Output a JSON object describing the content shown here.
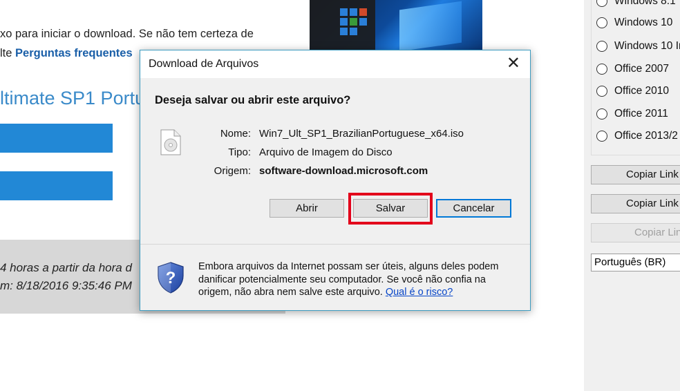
{
  "background_page": {
    "text_line1": "xo para iniciar o download. Se não tem certeza de",
    "text_line2_prefix": "lte ",
    "text_line2_link": "Perguntas frequentes",
    "heading": "ltimate SP1 Portu",
    "gray_line1": "4 horas a partir da hora d",
    "gray_line2": "m: 8/18/2016 9:35:46 PM"
  },
  "right_panel": {
    "radio_options": [
      "Windows 8.1",
      "Windows 10",
      "Windows 10 In",
      "Office 2007",
      "Office 2010",
      "Office 2011",
      "Office 2013/2"
    ],
    "copy_buttons": [
      "Copiar Link",
      "Copiar Link",
      "Copiar Lin"
    ],
    "language_select": "Português (BR)"
  },
  "dialog": {
    "title": "Download de Arquivos",
    "close_symbol": "✕",
    "question": "Deseja salvar ou abrir este arquivo?",
    "fields": [
      {
        "label": "Nome:",
        "value": "Win7_Ult_SP1_BrazilianPortuguese_x64.iso"
      },
      {
        "label": "Tipo:",
        "value": "Arquivo de Imagem do Disco"
      },
      {
        "label": "Origem:",
        "value": "software-download.microsoft.com"
      }
    ],
    "buttons": {
      "open": "Abrir",
      "save": "Salvar",
      "cancel": "Cancelar"
    },
    "warning_text": "Embora arquivos da Internet possam ser úteis, alguns deles podem danificar potencialmente seu computador. Se você não confia na origem, não abra nem salve este arquivo.",
    "warning_link": "Qual é o risco?"
  },
  "icons": [
    "file-iso-icon",
    "shield-warning-icon",
    "close-icon",
    "radio-icon"
  ],
  "colors": {
    "highlight": "#e3001b",
    "accent": "#0078d7",
    "page_blue": "#2288d6",
    "dialog_border": "#3c9bbf"
  }
}
